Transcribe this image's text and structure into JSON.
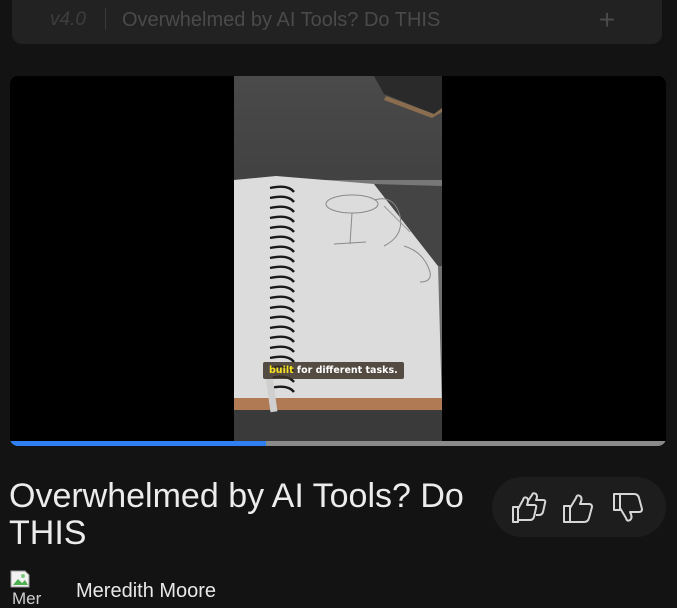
{
  "topbar": {
    "version": "v4.0",
    "title": "Overwhelmed by AI Tools? Do THIS",
    "add_icon": "plus-icon"
  },
  "player": {
    "caption_highlight": "built",
    "caption_rest": " for different tasks.",
    "progress": 0.39
  },
  "video": {
    "title": "Overwhelmed by AI Tools? Do THIS"
  },
  "reactions": {
    "icons": [
      "double-thumbs-up-icon",
      "thumbs-up-icon",
      "thumbs-down-icon"
    ]
  },
  "author": {
    "avatar_alt": "Mer",
    "name": "Meredith Moore"
  },
  "colors": {
    "background": "#131313",
    "progress_fill": "#2f7ff2",
    "caption_highlight": "#f7e21f"
  }
}
